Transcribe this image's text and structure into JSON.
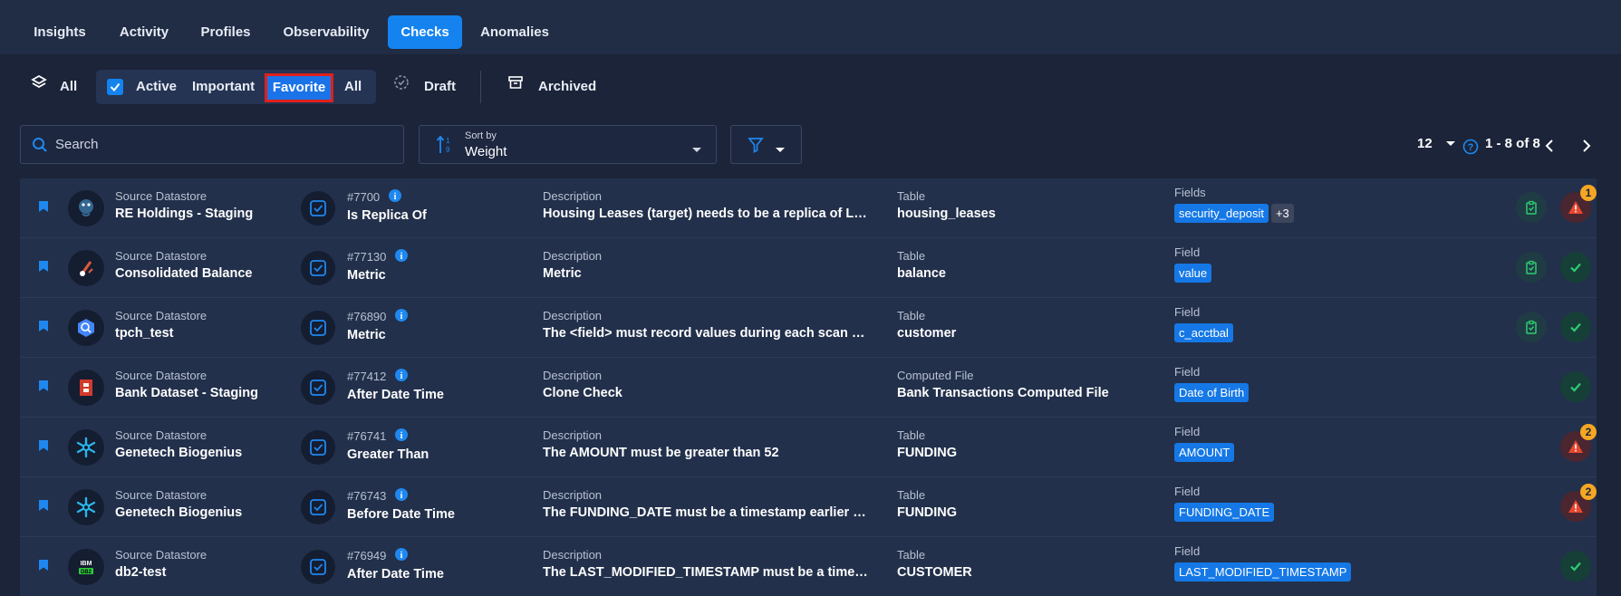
{
  "tabs": [
    {
      "label": "Insights"
    },
    {
      "label": "Activity"
    },
    {
      "label": "Profiles"
    },
    {
      "label": "Observability"
    },
    {
      "label": "Checks"
    },
    {
      "label": "Anomalies"
    }
  ],
  "filters": {
    "all": "All",
    "active": "Active",
    "important": "Important",
    "favorite": "Favorite",
    "all2": "All",
    "draft": "Draft",
    "archived": "Archived"
  },
  "search": {
    "placeholder": "Search"
  },
  "sort": {
    "label": "Sort by",
    "value": "Weight"
  },
  "pager": {
    "page_size": "12",
    "range": "1 - 8 of 8"
  },
  "rows": [
    {
      "ds_label": "Source Datastore",
      "ds_name": "RE Holdings - Staging",
      "id": "#7700",
      "rule": "Is Replica Of",
      "desc_label": "Description",
      "desc": "Housing Leases (target) needs to be a replica of Leases (Ref)",
      "table_label": "Table",
      "table": "housing_leases",
      "field_label": "Fields",
      "field": "security_deposit",
      "more": "+3",
      "status": "warn",
      "badge": "1",
      "ds_icon": "postgres-icon"
    },
    {
      "ds_label": "Source Datastore",
      "ds_name": "Consolidated Balance",
      "id": "#77130",
      "rule": "Metric",
      "desc_label": "Description",
      "desc": "Metric",
      "table_label": "Table",
      "table": "balance",
      "field_label": "Field",
      "field": "value",
      "more": "",
      "status": "ok",
      "badge": "",
      "ds_icon": "database-icon"
    },
    {
      "ds_label": "Source Datastore",
      "ds_name": "tpch_test",
      "id": "#76890",
      "rule": "Metric",
      "desc_label": "Description",
      "desc": "The <field> must record values during each scan and a metric",
      "table_label": "Table",
      "table": "customer",
      "field_label": "Field",
      "field": "c_acctbal",
      "more": "",
      "status": "ok",
      "badge": "",
      "ds_icon": "bigquery-icon"
    },
    {
      "ds_label": "Source Datastore",
      "ds_name": "Bank Dataset - Staging",
      "id": "#77412",
      "rule": "After Date Time",
      "desc_label": "Description",
      "desc": "Clone Check",
      "table_label": "Computed File",
      "table": "Bank Transactions Computed File",
      "field_label": "Field",
      "field": "Date of Birth",
      "more": "",
      "status": "ok",
      "badge": "",
      "ds_icon": "aws-icon"
    },
    {
      "ds_label": "Source Datastore",
      "ds_name": "Genetech Biogenius",
      "id": "#76741",
      "rule": "Greater Than",
      "desc_label": "Description",
      "desc": "The AMOUNT must be greater than 52",
      "table_label": "Table",
      "table": "FUNDING",
      "field_label": "Field",
      "field": "AMOUNT",
      "more": "",
      "status": "warn",
      "badge": "2",
      "ds_icon": "snowflake-icon"
    },
    {
      "ds_label": "Source Datastore",
      "ds_name": "Genetech Biogenius",
      "id": "#76743",
      "rule": "Before Date Time",
      "desc_label": "Description",
      "desc": "The FUNDING_DATE must be a timestamp earlier than a date",
      "table_label": "Table",
      "table": "FUNDING",
      "field_label": "Field",
      "field": "FUNDING_DATE",
      "more": "",
      "status": "warn",
      "badge": "2",
      "ds_icon": "snowflake-icon"
    },
    {
      "ds_label": "Source Datastore",
      "ds_name": "db2-test",
      "id": "#76949",
      "rule": "After Date Time",
      "desc_label": "Description",
      "desc": "The LAST_MODIFIED_TIMESTAMP must be a timestamp later than",
      "table_label": "Table",
      "table": "CUSTOMER",
      "field_label": "Field",
      "field": "LAST_MODIFIED_TIMESTAMP",
      "more": "",
      "status": "ok",
      "badge": "",
      "ds_icon": "db2-icon"
    }
  ],
  "colors": {
    "accent": "#1483ef",
    "success": "#2ecc71",
    "warning": "#e8472f",
    "badge": "#f5a623"
  }
}
